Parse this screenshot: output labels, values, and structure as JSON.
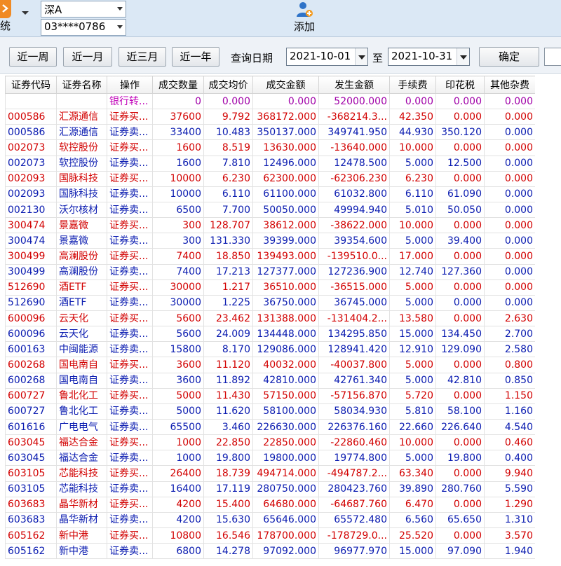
{
  "toolbar": {
    "system_label": "统",
    "market_select": "深A",
    "account_select": "03****0786",
    "add_label": "添加"
  },
  "query": {
    "buttons": [
      "近一周",
      "近一月",
      "近三月",
      "近一年"
    ],
    "date_label": "查询日期",
    "start_date": "2021-10-01",
    "to_label": "至",
    "end_date": "2021-10-31",
    "confirm_label": "确定"
  },
  "table": {
    "columns": [
      "证券代码",
      "证券名称",
      "操作",
      "成交数量",
      "成交均价",
      "成交金额",
      "发生金额",
      "手续费",
      "印花税",
      "其他杂费"
    ],
    "rows": [
      {
        "type": "bank",
        "cells": [
          "",
          "",
          "银行转...",
          "0",
          "0.000",
          "0.000",
          "52000.000",
          "0.000",
          "0.000",
          "0.000"
        ]
      },
      {
        "type": "buy",
        "cells": [
          "000586",
          "汇源通信",
          "证券买...",
          "37600",
          "9.792",
          "368172.000",
          "-368214.3...",
          "42.350",
          "0.000",
          "0.000"
        ]
      },
      {
        "type": "sell",
        "cells": [
          "000586",
          "汇源通信",
          "证券卖...",
          "33400",
          "10.483",
          "350137.000",
          "349741.950",
          "44.930",
          "350.120",
          "0.000"
        ]
      },
      {
        "type": "buy",
        "cells": [
          "002073",
          "软控股份",
          "证券买...",
          "1600",
          "8.519",
          "13630.000",
          "-13640.000",
          "10.000",
          "0.000",
          "0.000"
        ]
      },
      {
        "type": "sell",
        "cells": [
          "002073",
          "软控股份",
          "证券卖...",
          "1600",
          "7.810",
          "12496.000",
          "12478.500",
          "5.000",
          "12.500",
          "0.000"
        ]
      },
      {
        "type": "buy",
        "cells": [
          "002093",
          "国脉科技",
          "证券买...",
          "10000",
          "6.230",
          "62300.000",
          "-62306.230",
          "6.230",
          "0.000",
          "0.000"
        ]
      },
      {
        "type": "sell",
        "cells": [
          "002093",
          "国脉科技",
          "证券卖...",
          "10000",
          "6.110",
          "61100.000",
          "61032.800",
          "6.110",
          "61.090",
          "0.000"
        ]
      },
      {
        "type": "sell",
        "cells": [
          "002130",
          "沃尔核材",
          "证券卖...",
          "6500",
          "7.700",
          "50050.000",
          "49994.940",
          "5.010",
          "50.050",
          "0.000"
        ]
      },
      {
        "type": "buy",
        "cells": [
          "300474",
          "景嘉微",
          "证券买...",
          "300",
          "128.707",
          "38612.000",
          "-38622.000",
          "10.000",
          "0.000",
          "0.000"
        ]
      },
      {
        "type": "sell",
        "cells": [
          "300474",
          "景嘉微",
          "证券卖...",
          "300",
          "131.330",
          "39399.000",
          "39354.600",
          "5.000",
          "39.400",
          "0.000"
        ]
      },
      {
        "type": "buy",
        "cells": [
          "300499",
          "高澜股份",
          "证券买...",
          "7400",
          "18.850",
          "139493.000",
          "-139510.0...",
          "17.000",
          "0.000",
          "0.000"
        ]
      },
      {
        "type": "sell",
        "cells": [
          "300499",
          "高澜股份",
          "证券卖...",
          "7400",
          "17.213",
          "127377.000",
          "127236.900",
          "12.740",
          "127.360",
          "0.000"
        ]
      },
      {
        "type": "buy",
        "cells": [
          "512690",
          "酒ETF",
          "证券买...",
          "30000",
          "1.217",
          "36510.000",
          "-36515.000",
          "5.000",
          "0.000",
          "0.000"
        ]
      },
      {
        "type": "sell",
        "cells": [
          "512690",
          "酒ETF",
          "证券卖...",
          "30000",
          "1.225",
          "36750.000",
          "36745.000",
          "5.000",
          "0.000",
          "0.000"
        ]
      },
      {
        "type": "buy",
        "cells": [
          "600096",
          "云天化",
          "证券买...",
          "5600",
          "23.462",
          "131388.000",
          "-131404.2...",
          "13.580",
          "0.000",
          "2.630"
        ]
      },
      {
        "type": "sell",
        "cells": [
          "600096",
          "云天化",
          "证券卖...",
          "5600",
          "24.009",
          "134448.000",
          "134295.850",
          "15.000",
          "134.450",
          "2.700"
        ]
      },
      {
        "type": "sell",
        "cells": [
          "600163",
          "中闽能源",
          "证券卖...",
          "15800",
          "8.170",
          "129086.000",
          "128941.420",
          "12.910",
          "129.090",
          "2.580"
        ]
      },
      {
        "type": "buy",
        "cells": [
          "600268",
          "国电南自",
          "证券买...",
          "3600",
          "11.120",
          "40032.000",
          "-40037.800",
          "5.000",
          "0.000",
          "0.800"
        ]
      },
      {
        "type": "sell",
        "cells": [
          "600268",
          "国电南自",
          "证券卖...",
          "3600",
          "11.892",
          "42810.000",
          "42761.340",
          "5.000",
          "42.810",
          "0.850"
        ]
      },
      {
        "type": "buy",
        "cells": [
          "600727",
          "鲁北化工",
          "证券买...",
          "5000",
          "11.430",
          "57150.000",
          "-57156.870",
          "5.720",
          "0.000",
          "1.150"
        ]
      },
      {
        "type": "sell",
        "cells": [
          "600727",
          "鲁北化工",
          "证券卖...",
          "5000",
          "11.620",
          "58100.000",
          "58034.930",
          "5.810",
          "58.100",
          "1.160"
        ]
      },
      {
        "type": "sell",
        "cells": [
          "601616",
          "广电电气",
          "证券卖...",
          "65500",
          "3.460",
          "226630.000",
          "226376.160",
          "22.660",
          "226.640",
          "4.540"
        ]
      },
      {
        "type": "buy",
        "cells": [
          "603045",
          "福达合金",
          "证券买...",
          "1000",
          "22.850",
          "22850.000",
          "-22860.460",
          "10.000",
          "0.000",
          "0.460"
        ]
      },
      {
        "type": "sell",
        "cells": [
          "603045",
          "福达合金",
          "证券卖...",
          "1000",
          "19.800",
          "19800.000",
          "19774.800",
          "5.000",
          "19.800",
          "0.400"
        ]
      },
      {
        "type": "buy",
        "cells": [
          "603105",
          "芯能科技",
          "证券买...",
          "26400",
          "18.739",
          "494714.000",
          "-494787.2...",
          "63.340",
          "0.000",
          "9.940"
        ]
      },
      {
        "type": "sell",
        "cells": [
          "603105",
          "芯能科技",
          "证券卖...",
          "16400",
          "17.119",
          "280750.000",
          "280423.760",
          "39.890",
          "280.760",
          "5.590"
        ]
      },
      {
        "type": "buy",
        "cells": [
          "603683",
          "晶华新材",
          "证券买...",
          "4200",
          "15.400",
          "64680.000",
          "-64687.760",
          "6.470",
          "0.000",
          "1.290"
        ]
      },
      {
        "type": "sell",
        "cells": [
          "603683",
          "晶华新材",
          "证券卖...",
          "4200",
          "15.630",
          "65646.000",
          "65572.480",
          "6.560",
          "65.650",
          "1.310"
        ]
      },
      {
        "type": "buy",
        "cells": [
          "605162",
          "新中港",
          "证券买...",
          "10800",
          "16.546",
          "178700.000",
          "-178729.0...",
          "25.520",
          "0.000",
          "3.570"
        ]
      },
      {
        "type": "sell",
        "cells": [
          "605162",
          "新中港",
          "证券卖...",
          "6800",
          "14.278",
          "97092.000",
          "96977.970",
          "15.000",
          "97.090",
          "1.940"
        ]
      }
    ]
  },
  "colors": {
    "buy": "#d20000",
    "sell": "#0a1bb0",
    "bank": "#a000a8",
    "toolbar_bg": "#dbe8f5"
  }
}
